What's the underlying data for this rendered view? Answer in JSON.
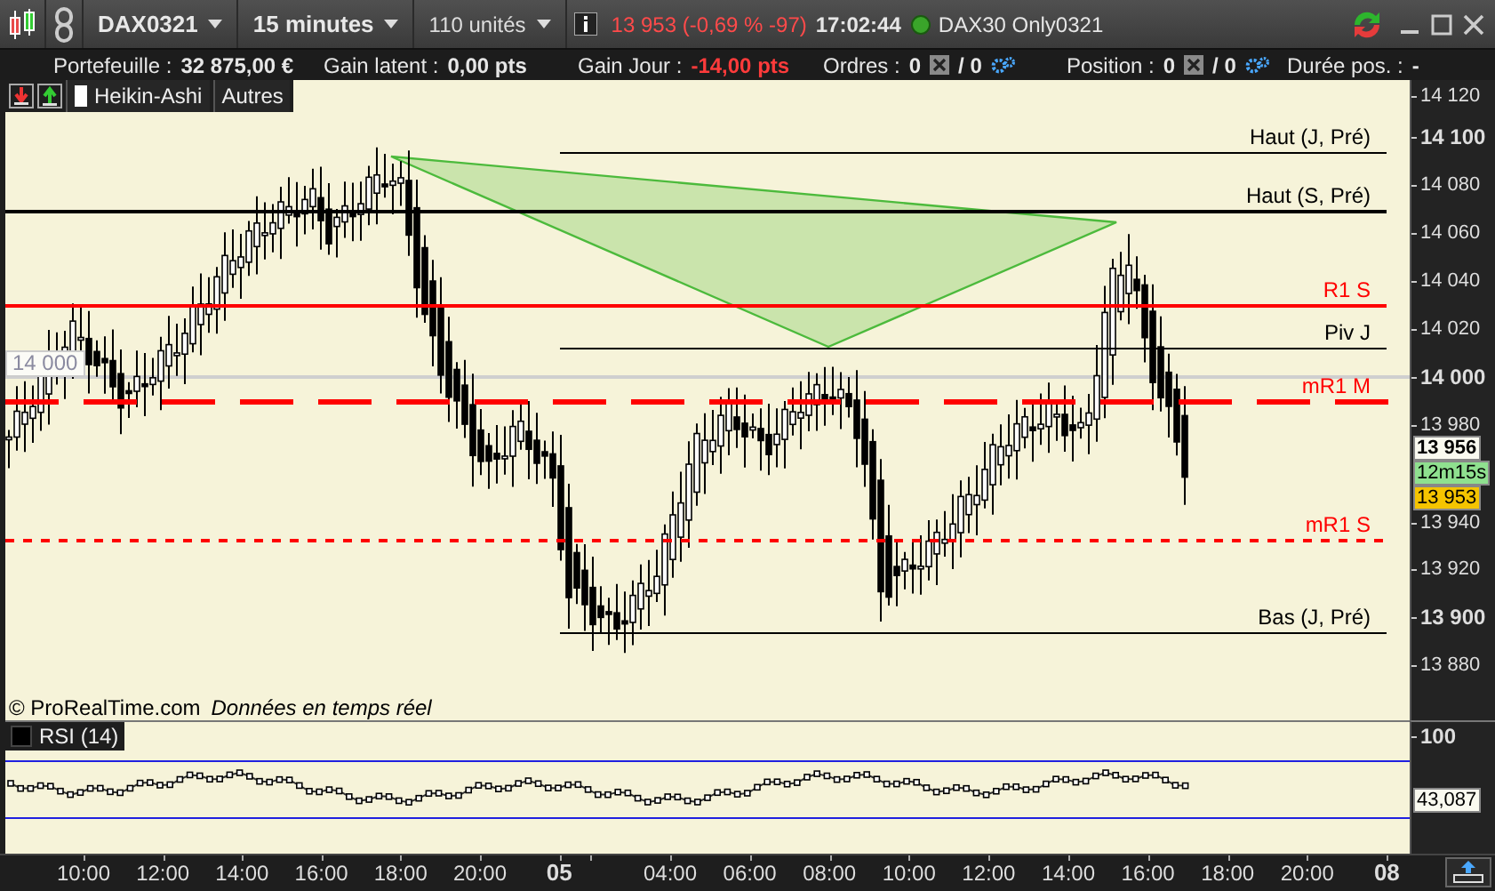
{
  "toolbar": {
    "instrument": "DAX0321",
    "timeframe": "15 minutes",
    "units": "110 unités",
    "quote": "13 953 (-0,69 % -97)",
    "time": "17:02:44",
    "account": "DAX30 Only0321"
  },
  "info_bar": {
    "portfolio_label": "Portefeuille :",
    "portfolio_value": "32 875,00 €",
    "latent_label": "Gain latent :",
    "latent_value": "0,00 pts",
    "day_label": "Gain Jour :",
    "day_value": "-14,00 pts",
    "orders_label": "Ordres :",
    "orders_count": "0",
    "orders_pending": "/ 0",
    "position_label": "Position :",
    "position_count": "0",
    "position_pending": "/ 0",
    "duration_label": "Durée pos. :",
    "duration_value": "-"
  },
  "chart_toolbar": {
    "buttons": [
      "Heikin-Ashi",
      "Autres"
    ]
  },
  "price_lines": [
    {
      "label": "Haut (J, Pré)",
      "color": "#000000",
      "kind": "short"
    },
    {
      "label": "Haut (S, Pré)",
      "color": "#000000",
      "kind": "solid"
    },
    {
      "label": "R1 S",
      "color": "#ff0000",
      "kind": "solid"
    },
    {
      "label": "Piv J",
      "color": "#000000",
      "kind": "short"
    },
    {
      "label": "mR1 M",
      "color": "#ff0000",
      "kind": "dashed"
    },
    {
      "label": "mR1 S",
      "color": "#ff0000",
      "kind": "dotted"
    },
    {
      "label": "Bas (J, Pré)",
      "color": "#000000",
      "kind": "short"
    }
  ],
  "price_axis": {
    "ticks": [
      {
        "label": "14 120",
        "major": false
      },
      {
        "label": "14 100",
        "major": true
      },
      {
        "label": "14 080",
        "major": false
      },
      {
        "label": "14 060",
        "major": false
      },
      {
        "label": "14 040",
        "major": false
      },
      {
        "label": "14 020",
        "major": false
      },
      {
        "label": "14 000",
        "major": true
      },
      {
        "label": "13 980",
        "major": false
      },
      {
        "label": "13 940",
        "major": false
      },
      {
        "label": "13 920",
        "major": false
      },
      {
        "label": "13 900",
        "major": true
      },
      {
        "label": "13 880",
        "major": false
      }
    ],
    "tags": [
      {
        "kind": "bid",
        "label": "13 956"
      },
      {
        "kind": "timer",
        "label": "12m15s"
      },
      {
        "kind": "last",
        "label": "13 953"
      }
    ]
  },
  "crosshair_label": "14 000",
  "footer": {
    "source": "© ProRealTime.com",
    "feed": "Données en temps réel"
  },
  "rsi": {
    "label": "RSI (14)",
    "axis_label": "100",
    "value_tag": "43,087"
  },
  "time_axis": [
    {
      "label": "10:00",
      "major": false
    },
    {
      "label": "12:00",
      "major": false
    },
    {
      "label": "14:00",
      "major": false
    },
    {
      "label": "16:00",
      "major": false
    },
    {
      "label": "18:00",
      "major": false
    },
    {
      "label": "20:00",
      "major": false
    },
    {
      "label": "05",
      "major": true
    },
    {
      "label": "04:00",
      "major": false
    },
    {
      "label": "06:00",
      "major": false
    },
    {
      "label": "08:00",
      "major": false
    },
    {
      "label": "10:00",
      "major": false
    },
    {
      "label": "12:00",
      "major": false
    },
    {
      "label": "14:00",
      "major": false
    },
    {
      "label": "16:00",
      "major": false
    },
    {
      "label": "18:00",
      "major": false
    },
    {
      "label": "20:00",
      "major": false
    },
    {
      "label": "08",
      "major": true
    }
  ]
}
